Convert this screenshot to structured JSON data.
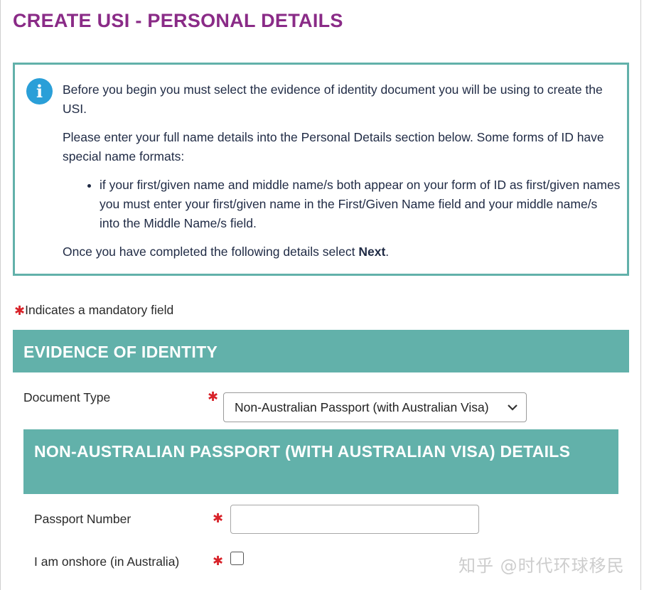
{
  "colors": {
    "title": "#8a2b87",
    "section_bar": "#62b1aa",
    "info_border": "#62b1aa",
    "info_icon": "#2a9fd8",
    "mandatory_star": "#d8232a"
  },
  "page": {
    "title": "CREATE USI - PERSONAL DETAILS"
  },
  "info": {
    "icon": "info-circle-icon",
    "para1": "Before you begin you must select the evidence of identity document you will be using to create the USI.",
    "para2": "Please enter your full name details into the Personal Details section below. Some forms of ID have special name formats:",
    "bullets": [
      "if your first/given name and middle name/s both appear on your form of ID as first/given names you must enter your first/given name in the First/Given Name field and your middle name/s into the Middle Name/s field."
    ],
    "para3_prefix": "Once you have completed the following details select ",
    "para3_bold": "Next",
    "para3_suffix": "."
  },
  "mandatory_note": "Indicates a mandatory field",
  "star_glyph": "✱",
  "evidence": {
    "header": "EVIDENCE OF IDENTITY",
    "document_type_label": "Document Type",
    "document_type_value": "Non-Australian Passport (with Australian Visa)"
  },
  "passport": {
    "header": "NON-AUSTRALIAN PASSPORT (WITH AUSTRALIAN VISA) DETAILS",
    "number_label": "Passport Number",
    "number_value": "",
    "onshore_label": "I am onshore (in Australia)",
    "onshore_checked": false
  },
  "watermark": "知乎 @时代环球移民"
}
